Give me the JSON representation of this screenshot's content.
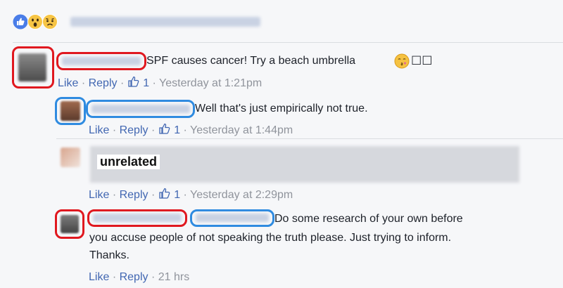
{
  "reactions": {
    "icons": [
      "like-icon",
      "wow-icon",
      "sad-icon"
    ]
  },
  "comments": [
    {
      "text": "SPF causes cancer! Try a beach umbrella",
      "trailing_glyphs": "☐☐",
      "emoji": "kiss-emoji-icon",
      "actions": {
        "like": "Like",
        "reply": "Reply",
        "sep": "·",
        "likes": "1",
        "time": "Yesterday at 1:21pm"
      }
    },
    {
      "text": "Well that's just empirically not true.",
      "actions": {
        "like": "Like",
        "reply": "Reply",
        "sep": "·",
        "likes": "1",
        "time": "Yesterday at 1:44pm"
      }
    },
    {
      "label": "unrelated",
      "actions": {
        "like": "Like",
        "reply": "Reply",
        "sep": "·",
        "likes": "1",
        "time": "Yesterday at 2:29pm"
      }
    },
    {
      "text_line1": "Do some research of your own before",
      "text_line2": "you accuse people of not speaking the truth please. Just trying to inform.",
      "text_line3": "Thanks.",
      "actions": {
        "like": "Like",
        "reply": "Reply",
        "sep": "·",
        "time": "21 hrs"
      }
    }
  ],
  "colors": {
    "annotation_red": "#e0181f",
    "annotation_blue": "#2f8be0",
    "link": "#4267b2",
    "meta": "#90949c"
  }
}
